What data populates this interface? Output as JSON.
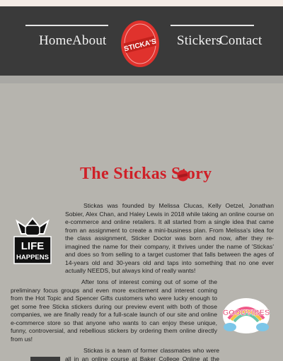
{
  "nav": {
    "links": [
      "Home",
      "About",
      "Stickers",
      "Contact"
    ],
    "logo_text": "STICKA'S",
    "logo_color": "#e0322d"
  },
  "story": {
    "title": "The Stickas Story",
    "paragraphs": [
      "Stickas was founded by Melissa Clucas, Kelly Oetzel, Jonathan Sobier, Alex Chan, and Haley Lewis in 2018 while taking an online course on e-commerce and online retailers. It all started from a single idea that came from an assignment to create a mini-business plan. From Melissa's idea for the class assignment, Sticker Doctor was born and now, after they re-imagined the name for their company, it thrives under the name of 'Stickas' and does so from selling to a target customer that falls between the ages of 14-years old and 30-years old and taps into something that no one ever actually NEEDS, but always kind of really wants!",
      "After tons of interest coming out of some of the preliminary focus groups and even more excitement and interest coming from the Hot Topic and Spencer Gifts customers who were lucky enough to get some free Sticka stickers during our preview event with both of those companies, we are finally ready for a full-scale launch of our site and online e-commerce store so that anyone who wants to can enjoy these unique, funny, controversial, and rebellious stickers by ordering them online directly from us!",
      "Stickas is a team of former classmates who were all in an online course at Baker College Online at the same time and were"
    ],
    "stickers": {
      "life_happens": [
        "LIFE",
        "HAPPENS"
      ],
      "good_vibes": "GOODVIBES"
    }
  },
  "colors": {
    "accent": "#cf1f27",
    "navbar": "#3a3a3a",
    "background": "#b6b4ae"
  }
}
